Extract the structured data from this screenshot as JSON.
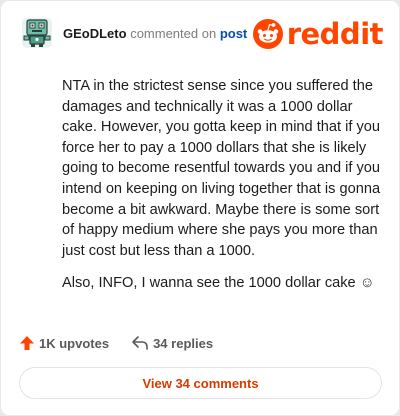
{
  "comment": {
    "username": "GEoDLeto",
    "action_text": "commented on",
    "post_link": "post",
    "paragraphs": [
      "NTA in the strictest sense since you suffered the damages and technically it was a 1000 dollar cake. However, you gotta keep in mind that if you force her to pay a 1000 dollars that she is likely going to become resentful towards you and if you intend on keeping on living together that is gonna become a bit awkward. Maybe there is some sort of happy medium where she pays you more than just cost but less than a 1000.",
      "Also, INFO, I wanna see the 1000 dollar cake ☺"
    ]
  },
  "brand": {
    "wordmark": "reddit",
    "color": "#ff4500"
  },
  "actions": {
    "upvotes": "1K upvotes",
    "replies": "34 replies"
  },
  "view_button": {
    "label": "View 34 comments"
  },
  "icons": {
    "avatar": "robot-avatar-icon",
    "upvote": "upvote-arrow-icon",
    "reply": "reply-arrow-icon",
    "logo": "reddit-snoo-icon"
  },
  "colors": {
    "accent": "#ff4500",
    "link": "#0a4fa6",
    "button_text": "#d93a00"
  }
}
